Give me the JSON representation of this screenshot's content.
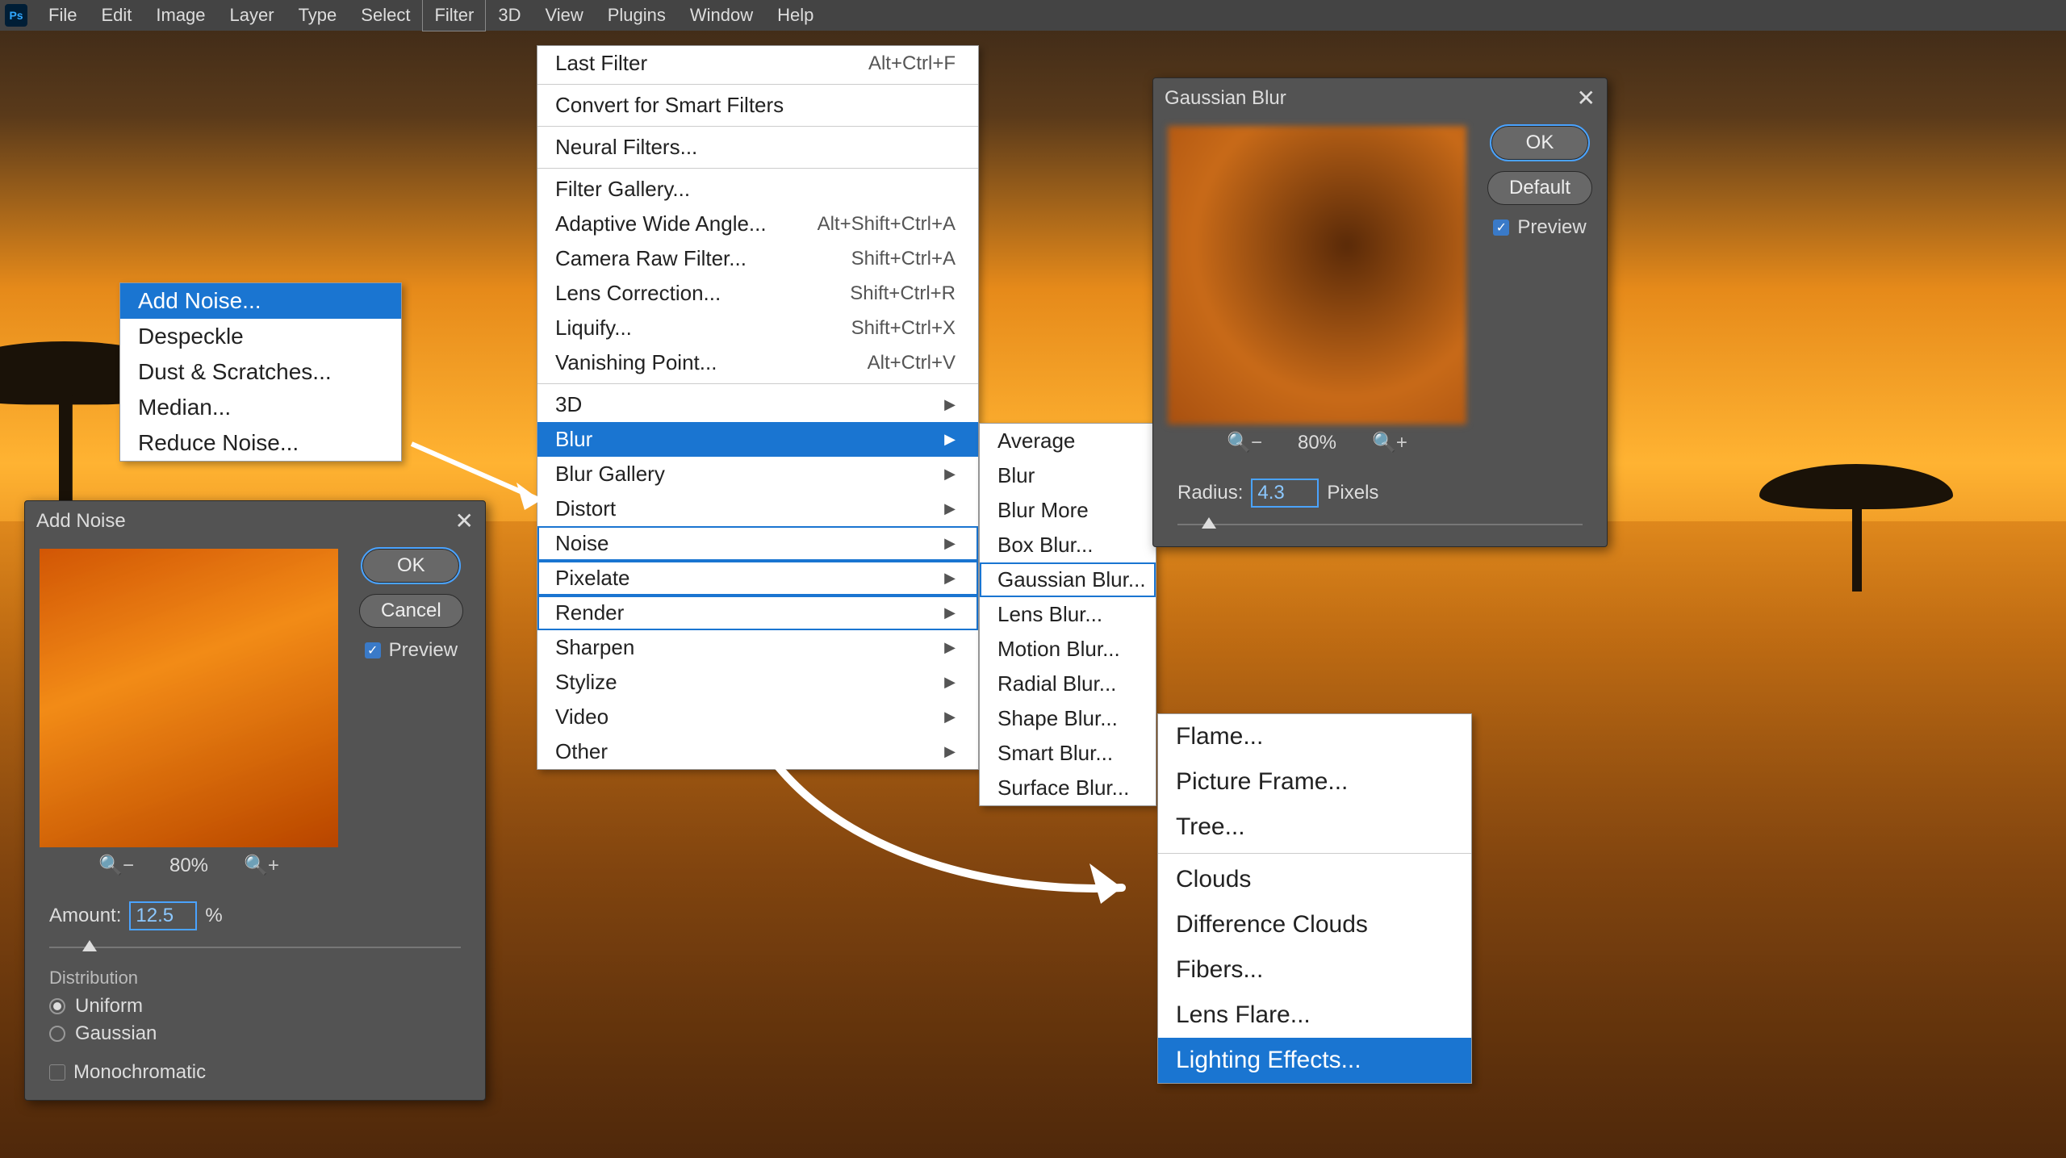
{
  "menubar": {
    "items": [
      "File",
      "Edit",
      "Image",
      "Layer",
      "Type",
      "Select",
      "Filter",
      "3D",
      "View",
      "Plugins",
      "Window",
      "Help"
    ],
    "open_index": 6
  },
  "noise_submenu": {
    "items": [
      "Add Noise...",
      "Despeckle",
      "Dust & Scratches...",
      "Median...",
      "Reduce Noise..."
    ],
    "selected_index": 0
  },
  "filter_menu": {
    "top": [
      {
        "label": "Last Filter",
        "shortcut": "Alt+Ctrl+F"
      }
    ],
    "group1": [
      {
        "label": "Convert for Smart Filters"
      }
    ],
    "group2": [
      {
        "label": "Neural Filters..."
      }
    ],
    "group3": [
      {
        "label": "Filter Gallery..."
      },
      {
        "label": "Adaptive Wide Angle...",
        "shortcut": "Alt+Shift+Ctrl+A"
      },
      {
        "label": "Camera Raw Filter...",
        "shortcut": "Shift+Ctrl+A"
      },
      {
        "label": "Lens Correction...",
        "shortcut": "Shift+Ctrl+R"
      },
      {
        "label": "Liquify...",
        "shortcut": "Shift+Ctrl+X"
      },
      {
        "label": "Vanishing Point...",
        "shortcut": "Alt+Ctrl+V"
      }
    ],
    "group4": [
      {
        "label": "3D",
        "sub": true
      },
      {
        "label": "Blur",
        "sub": true,
        "selected": true
      },
      {
        "label": "Blur Gallery",
        "sub": true
      },
      {
        "label": "Distort",
        "sub": true
      },
      {
        "label": "Noise",
        "sub": true,
        "outline": true
      },
      {
        "label": "Pixelate",
        "sub": true,
        "outline": true
      },
      {
        "label": "Render",
        "sub": true,
        "outline": true
      },
      {
        "label": "Sharpen",
        "sub": true
      },
      {
        "label": "Stylize",
        "sub": true
      },
      {
        "label": "Video",
        "sub": true
      },
      {
        "label": "Other",
        "sub": true
      }
    ]
  },
  "blur_submenu": {
    "items": [
      "Average",
      "Blur",
      "Blur More",
      "Box Blur...",
      "Gaussian Blur...",
      "Lens Blur...",
      "Motion Blur...",
      "Radial Blur...",
      "Shape Blur...",
      "Smart Blur...",
      "Surface Blur..."
    ],
    "outlined_index": 4
  },
  "render_submenu": {
    "group1": [
      "Flame...",
      "Picture Frame...",
      "Tree..."
    ],
    "group2": [
      "Clouds",
      "Difference Clouds",
      "Fibers...",
      "Lens Flare...",
      "Lighting Effects..."
    ],
    "selected_label": "Lighting Effects..."
  },
  "add_noise_dialog": {
    "title": "Add Noise",
    "ok": "OK",
    "cancel": "Cancel",
    "preview_label": "Preview",
    "preview_checked": true,
    "zoom": "80%",
    "amount_label": "Amount:",
    "amount_value": "12.5",
    "amount_unit": "%",
    "distribution_label": "Distribution",
    "uniform_label": "Uniform",
    "gaussian_label": "Gaussian",
    "uniform_selected": true,
    "mono_label": "Monochromatic",
    "mono_checked": false
  },
  "gaussian_dialog": {
    "title": "Gaussian Blur",
    "ok": "OK",
    "default": "Default",
    "preview_label": "Preview",
    "preview_checked": true,
    "zoom": "80%",
    "radius_label": "Radius:",
    "radius_value": "4.3",
    "radius_unit": "Pixels"
  }
}
